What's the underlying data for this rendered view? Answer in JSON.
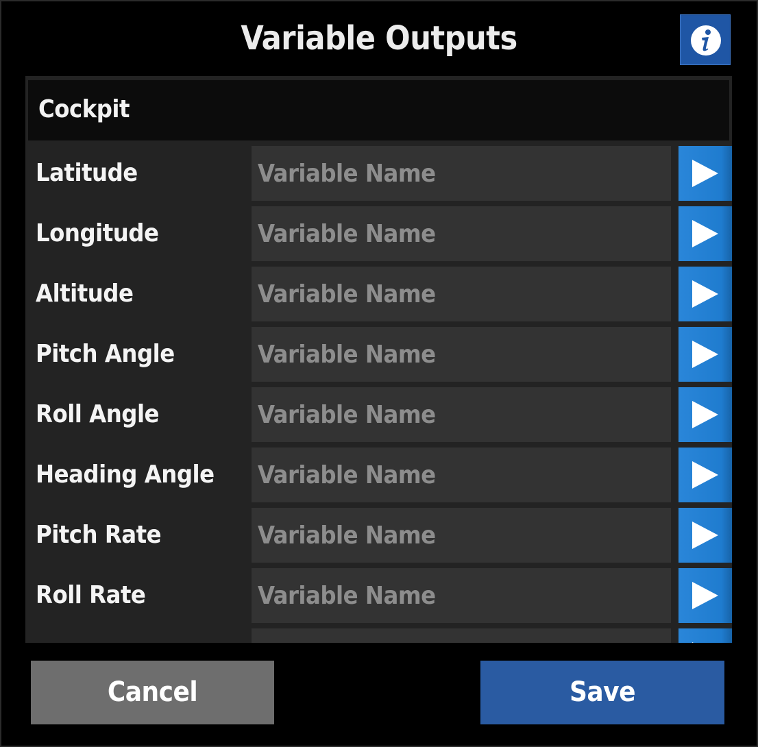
{
  "dialog": {
    "title": "Variable Outputs",
    "info_button_glyph": "i"
  },
  "section": {
    "title": "Cockpit"
  },
  "rows": [
    {
      "label": "Latitude",
      "value": "",
      "placeholder": "Variable Name"
    },
    {
      "label": "Longitude",
      "value": "",
      "placeholder": "Variable Name"
    },
    {
      "label": "Altitude",
      "value": "",
      "placeholder": "Variable Name"
    },
    {
      "label": "Pitch Angle",
      "value": "",
      "placeholder": "Variable Name"
    },
    {
      "label": "Roll Angle",
      "value": "",
      "placeholder": "Variable Name"
    },
    {
      "label": "Heading Angle",
      "value": "",
      "placeholder": "Variable Name"
    },
    {
      "label": "Pitch Rate",
      "value": "",
      "placeholder": "Variable Name"
    },
    {
      "label": "Roll Rate",
      "value": "",
      "placeholder": "Variable Name"
    },
    {
      "label": "",
      "value": "",
      "placeholder": ""
    }
  ],
  "icons": {
    "info": "info-icon",
    "row_action": "play-arrow-icon"
  },
  "footer": {
    "cancel_label": "Cancel",
    "save_label": "Save"
  },
  "colors": {
    "background": "#000000",
    "panel": "#232323",
    "section_header": "#0c0c0c",
    "input": "#333333",
    "placeholder_text": "#8d8d8d",
    "accent_blue": "#1f7ccf",
    "info_button": "#1f56a5",
    "cancel_button": "#6e6e6e",
    "save_button": "#2a5ba2"
  }
}
